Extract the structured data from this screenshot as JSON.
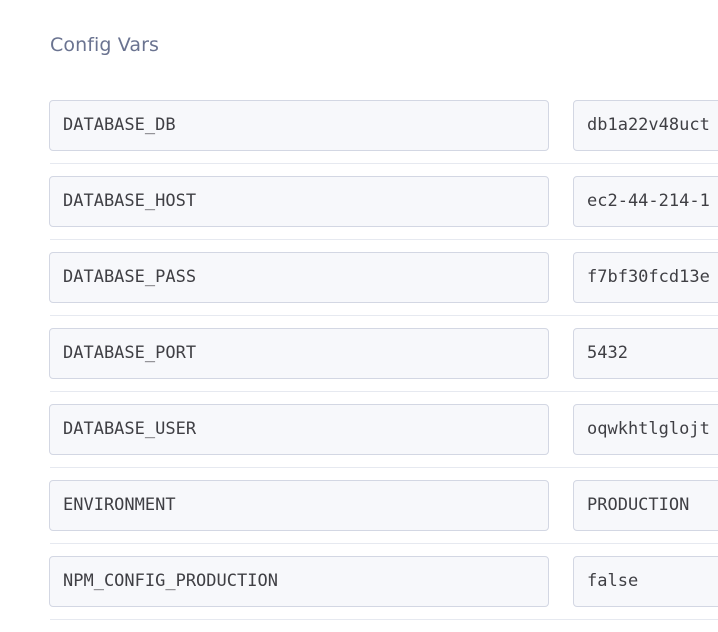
{
  "section": {
    "title": "Config Vars"
  },
  "config_vars": [
    {
      "key": "DATABASE_DB",
      "value": "db1a22v48uct"
    },
    {
      "key": "DATABASE_HOST",
      "value": "ec2-44-214-1"
    },
    {
      "key": "DATABASE_PASS",
      "value": "f7bf30fcd13e"
    },
    {
      "key": "DATABASE_PORT",
      "value": "5432"
    },
    {
      "key": "DATABASE_USER",
      "value": "oqwkhtlglojt"
    },
    {
      "key": "ENVIRONMENT",
      "value": "PRODUCTION"
    },
    {
      "key": "NPM_CONFIG_PRODUCTION",
      "value": "false"
    }
  ]
}
